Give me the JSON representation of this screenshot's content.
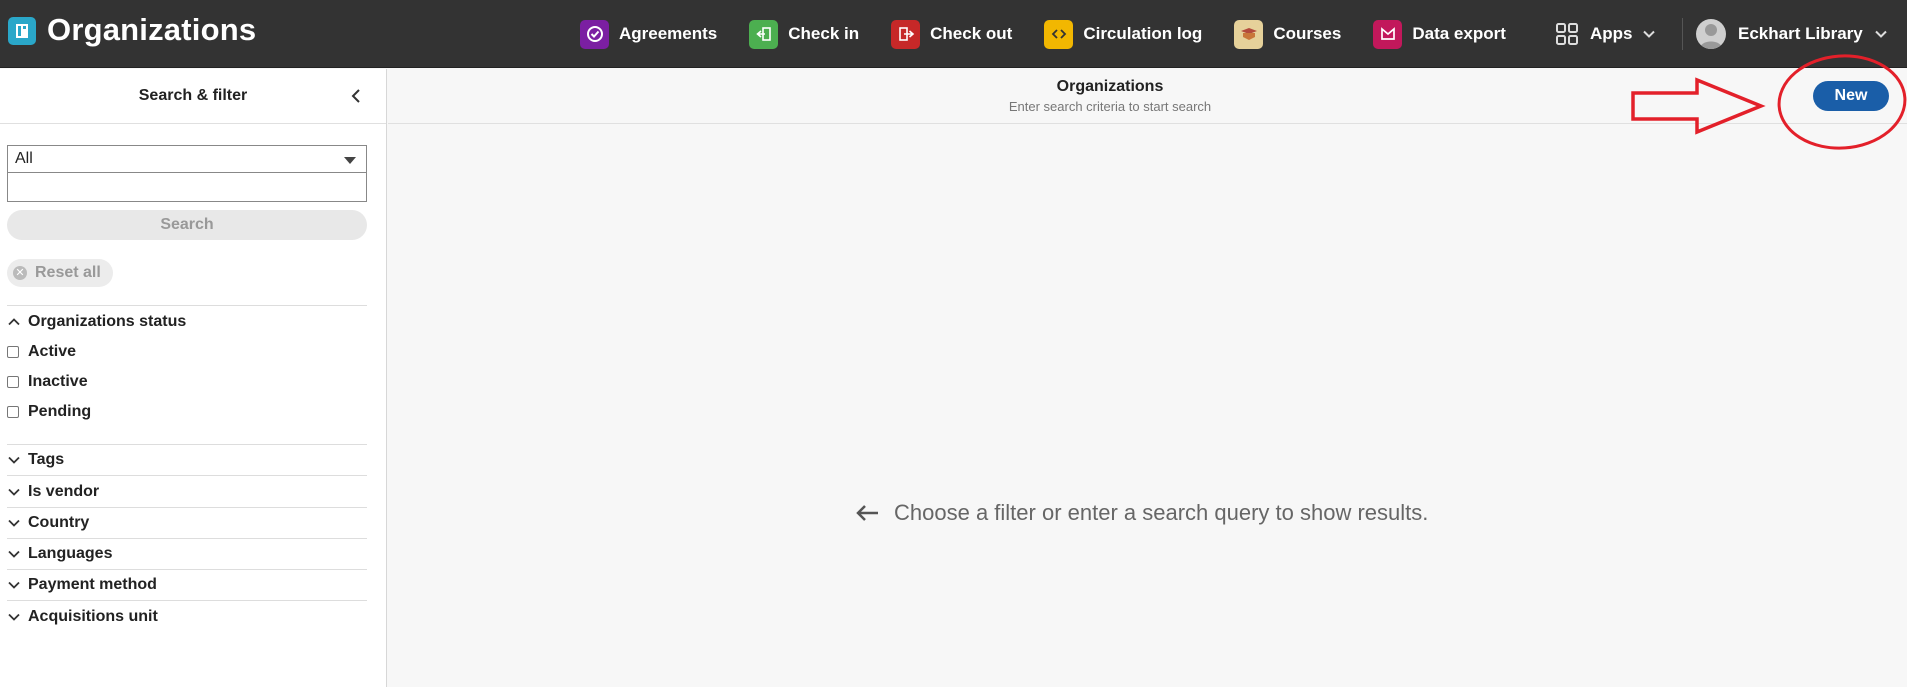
{
  "app": {
    "title": "Organizations",
    "logo_icon": "organizations-logo-icon"
  },
  "nav": {
    "items": [
      {
        "label": "Agreements",
        "icon": "agreements-icon",
        "color": "#7b1fa2"
      },
      {
        "label": "Check in",
        "icon": "check-in-icon",
        "color": "#4caf50"
      },
      {
        "label": "Check out",
        "icon": "check-out-icon",
        "color": "#c62828"
      },
      {
        "label": "Circulation log",
        "icon": "circulation-log-icon",
        "color": "#f2b701"
      },
      {
        "label": "Courses",
        "icon": "courses-icon",
        "color": "#e6d19a"
      },
      {
        "label": "Data export",
        "icon": "data-export-icon",
        "color": "#c2185b"
      }
    ],
    "apps_label": "Apps",
    "user_label": "Eckhart Library"
  },
  "filter": {
    "title": "Search & filter",
    "select_value": "All",
    "search_placeholder": "",
    "search_label": "Search",
    "reset_label": "Reset all",
    "sections": [
      {
        "label": "Organizations status",
        "expanded": true,
        "options": [
          "Active",
          "Inactive",
          "Pending"
        ]
      },
      {
        "label": "Tags",
        "expanded": false
      },
      {
        "label": "Is vendor",
        "expanded": false
      },
      {
        "label": "Country",
        "expanded": false
      },
      {
        "label": "Languages",
        "expanded": false
      },
      {
        "label": "Payment method",
        "expanded": false
      },
      {
        "label": "Acquisitions unit",
        "expanded": false
      }
    ]
  },
  "main": {
    "title": "Organizations",
    "subtitle": "Enter search criteria to start search",
    "new_label": "New",
    "empty_message": "Choose a filter or enter a search query to show results."
  },
  "colors": {
    "topbar": "#333333",
    "primary_button": "#1a5ea8",
    "annotation": "#e3202a"
  }
}
